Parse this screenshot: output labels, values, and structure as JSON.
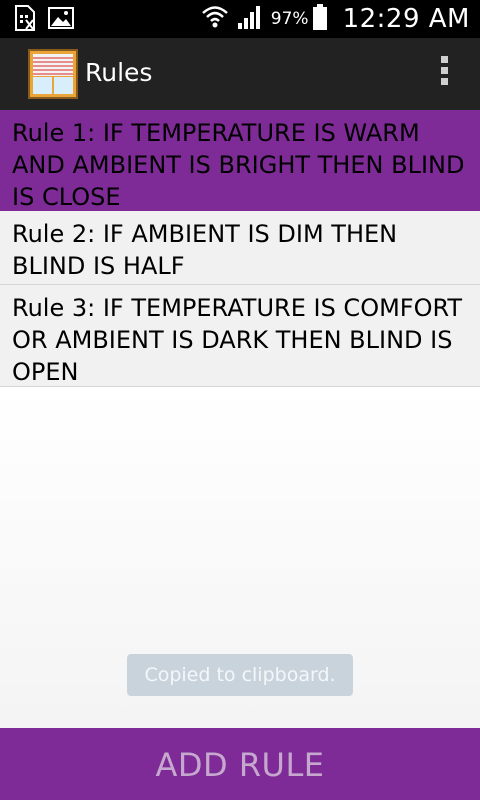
{
  "status_bar": {
    "battery_percent": "97%",
    "time": "12:29 AM",
    "icons": [
      "sim-card-icon",
      "image-notification-icon",
      "wifi-icon",
      "signal-icon",
      "battery-icon"
    ]
  },
  "action_bar": {
    "title": "Rules",
    "app_icon": "window-blind-icon",
    "overflow_icon": "overflow-menu-icon"
  },
  "rules": [
    {
      "text": "Rule 1: IF TEMPERATURE IS WARM AND AMBIENT IS BRIGHT THEN BLIND IS CLOSE",
      "selected": true
    },
    {
      "text": "Rule 2: IF AMBIENT IS DIM THEN BLIND IS HALF",
      "selected": false
    },
    {
      "text": "Rule 3: IF TEMPERATURE IS COMFORT OR AMBIENT IS DARK THEN BLIND IS OPEN",
      "selected": false
    }
  ],
  "toast": {
    "message": "Copied to clipboard."
  },
  "bottom_button": {
    "label": "ADD RULE"
  },
  "colors": {
    "accent": "#7e2a97",
    "action_bar": "#222222",
    "status_bar": "#000000",
    "toast_bg": "#c9d3dc"
  }
}
